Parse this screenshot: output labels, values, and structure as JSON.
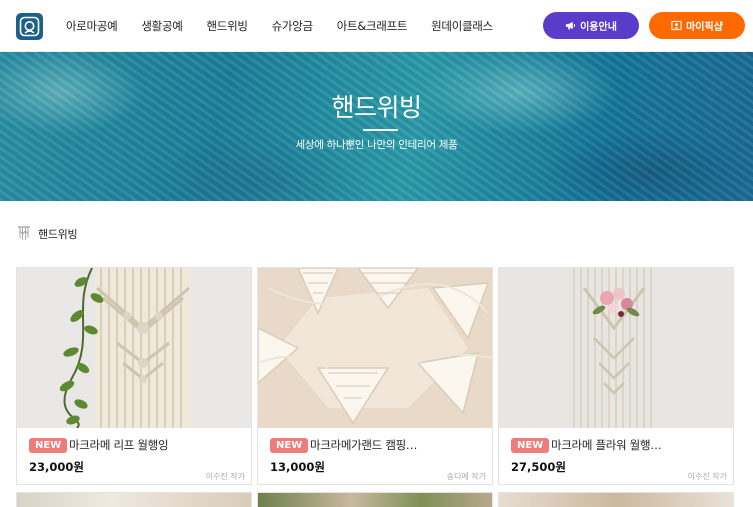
{
  "header": {
    "nav": [
      "아로마공예",
      "생활공예",
      "핸드위빙",
      "슈가앙금",
      "아트&크래프트",
      "원데이클래스"
    ],
    "guide_label": "이용안내",
    "mypage_label": "마이픽샵",
    "colors": {
      "guide_button": "#5b3bc9",
      "mypage_button": "#ff6a00"
    }
  },
  "hero": {
    "title": "핸드위빙",
    "subtitle": "세상에 하나뿐인 나만의 인테리어 제품"
  },
  "section": {
    "title": "핸드위빙"
  },
  "products": [
    {
      "badge": "NEW",
      "name": "마크라메 리프 월행잉",
      "price": "23,000원",
      "artist": "이수진 작가"
    },
    {
      "badge": "NEW",
      "name": "마크라메가랜드 캠핑…",
      "price": "13,000원",
      "artist": "송디에 작가"
    },
    {
      "badge": "NEW",
      "name": "마크라메 플라워 월행…",
      "price": "27,500원",
      "artist": "이수진 작가"
    }
  ]
}
